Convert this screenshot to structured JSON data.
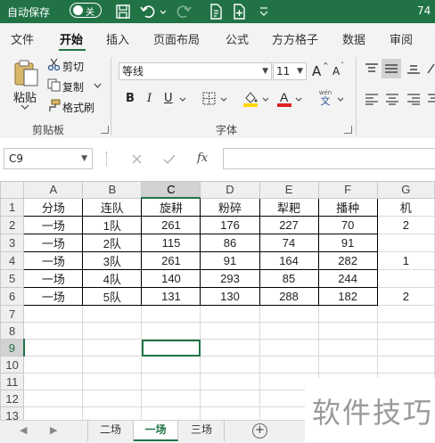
{
  "titlebar": {
    "autosave_label": "自动保存",
    "autosave_state": "关",
    "right_text": "74"
  },
  "tabs": [
    "文件",
    "开始",
    "插入",
    "页面布局",
    "公式",
    "方方格子",
    "数据",
    "审阅"
  ],
  "active_tab": "开始",
  "clipboard": {
    "paste": "粘贴",
    "cut": "剪切",
    "copy": "复制",
    "format_painter": "格式刷",
    "group_label": "剪贴板"
  },
  "font": {
    "name": "等线",
    "size": "11",
    "grow": "A",
    "shrink": "A",
    "bold": "B",
    "italic": "I",
    "underline": "U",
    "phonetic": "wén",
    "phonetic_sub": "文",
    "group_label": "字体"
  },
  "formula_bar": {
    "cell_ref": "C9",
    "fx": "fx"
  },
  "grid": {
    "columns": [
      "A",
      "B",
      "C",
      "D",
      "E",
      "F",
      "G"
    ],
    "rows": [
      {
        "n": "1",
        "cells": [
          "分场",
          "连队",
          "旋耕",
          "粉碎",
          "犁耙",
          "播种",
          "机"
        ]
      },
      {
        "n": "2",
        "cells": [
          "一场",
          "1队",
          "261",
          "176",
          "227",
          "70",
          "2"
        ]
      },
      {
        "n": "3",
        "cells": [
          "一场",
          "2队",
          "115",
          "86",
          "74",
          "91",
          ""
        ]
      },
      {
        "n": "4",
        "cells": [
          "一场",
          "3队",
          "261",
          "91",
          "164",
          "282",
          "1"
        ]
      },
      {
        "n": "5",
        "cells": [
          "一场",
          "4队",
          "140",
          "293",
          "85",
          "244",
          ""
        ]
      },
      {
        "n": "6",
        "cells": [
          "一场",
          "5队",
          "131",
          "130",
          "288",
          "182",
          "2"
        ]
      },
      {
        "n": "7",
        "cells": [
          "",
          "",
          "",
          "",
          "",
          "",
          ""
        ]
      },
      {
        "n": "8",
        "cells": [
          "",
          "",
          "",
          "",
          "",
          "",
          ""
        ]
      },
      {
        "n": "9",
        "cells": [
          "",
          "",
          "",
          "",
          "",
          "",
          ""
        ]
      },
      {
        "n": "10",
        "cells": [
          "",
          "",
          "",
          "",
          "",
          "",
          ""
        ]
      },
      {
        "n": "11",
        "cells": [
          "",
          "",
          "",
          "",
          "",
          "",
          ""
        ]
      },
      {
        "n": "12",
        "cells": [
          "",
          "",
          "",
          "",
          "",
          "",
          ""
        ]
      },
      {
        "n": "13",
        "cells": [
          "",
          "",
          "",
          "",
          "",
          "",
          ""
        ]
      }
    ]
  },
  "sheet_tabs": [
    "二场",
    "一场",
    "三场"
  ],
  "active_sheet": "一场",
  "watermark": "软件技巧",
  "colors": {
    "excel_green": "#217346",
    "highlight_yellow": "#ffd700",
    "font_red": "#e02020"
  }
}
